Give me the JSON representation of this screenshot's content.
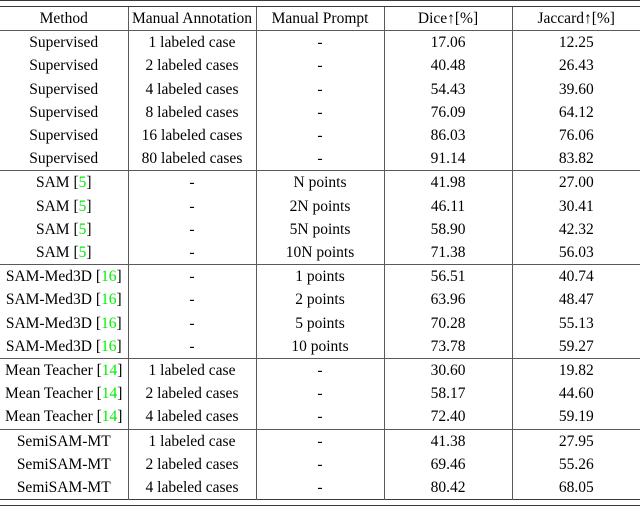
{
  "table": {
    "columns": [
      {
        "key": "method",
        "label": "Method"
      },
      {
        "key": "manual_annotation",
        "label": "Manual Annotation"
      },
      {
        "key": "manual_prompt",
        "label": "Manual Prompt"
      },
      {
        "key": "dice",
        "label": "Dice↑[%]"
      },
      {
        "key": "jaccard",
        "label": "Jaccard↑[%]"
      }
    ],
    "citation_color": "#00ee00",
    "groups": [
      {
        "name": "supervised",
        "rows": [
          {
            "method": "Supervised",
            "cite": "",
            "bold": false,
            "manual_annotation": "1 labeled case",
            "manual_prompt": "-",
            "dice": "17.06",
            "jaccard": "12.25"
          },
          {
            "method": "Supervised",
            "cite": "",
            "bold": false,
            "manual_annotation": "2 labeled cases",
            "manual_prompt": "-",
            "dice": "40.48",
            "jaccard": "26.43"
          },
          {
            "method": "Supervised",
            "cite": "",
            "bold": false,
            "manual_annotation": "4 labeled cases",
            "manual_prompt": "-",
            "dice": "54.43",
            "jaccard": "39.60"
          },
          {
            "method": "Supervised",
            "cite": "",
            "bold": false,
            "manual_annotation": "8 labeled cases",
            "manual_prompt": "-",
            "dice": "76.09",
            "jaccard": "64.12"
          },
          {
            "method": "Supervised",
            "cite": "",
            "bold": false,
            "manual_annotation": "16 labeled cases",
            "manual_prompt": "-",
            "dice": "86.03",
            "jaccard": "76.06"
          },
          {
            "method": "Supervised",
            "cite": "",
            "bold": false,
            "manual_annotation": "80 labeled cases",
            "manual_prompt": "-",
            "dice": "91.14",
            "jaccard": "83.82"
          }
        ]
      },
      {
        "name": "sam",
        "rows": [
          {
            "method": "SAM",
            "cite": "5",
            "bold": false,
            "manual_annotation": "-",
            "manual_prompt": "N points",
            "dice": "41.98",
            "jaccard": "27.00"
          },
          {
            "method": "SAM",
            "cite": "5",
            "bold": false,
            "manual_annotation": "-",
            "manual_prompt": "2N points",
            "dice": "46.11",
            "jaccard": "30.41"
          },
          {
            "method": "SAM",
            "cite": "5",
            "bold": false,
            "manual_annotation": "-",
            "manual_prompt": "5N points",
            "dice": "58.90",
            "jaccard": "42.32"
          },
          {
            "method": "SAM",
            "cite": "5",
            "bold": false,
            "manual_annotation": "-",
            "manual_prompt": "10N points",
            "dice": "71.38",
            "jaccard": "56.03"
          }
        ]
      },
      {
        "name": "sam-med3d",
        "rows": [
          {
            "method": "SAM-Med3D",
            "cite": "16",
            "bold": false,
            "manual_annotation": "-",
            "manual_prompt": "1 points",
            "dice": "56.51",
            "jaccard": "40.74"
          },
          {
            "method": "SAM-Med3D",
            "cite": "16",
            "bold": false,
            "manual_annotation": "-",
            "manual_prompt": "2 points",
            "dice": "63.96",
            "jaccard": "48.47"
          },
          {
            "method": "SAM-Med3D",
            "cite": "16",
            "bold": false,
            "manual_annotation": "-",
            "manual_prompt": "5 points",
            "dice": "70.28",
            "jaccard": "55.13"
          },
          {
            "method": "SAM-Med3D",
            "cite": "16",
            "bold": false,
            "manual_annotation": "-",
            "manual_prompt": "10 points",
            "dice": "73.78",
            "jaccard": "59.27"
          }
        ]
      },
      {
        "name": "mean-teacher",
        "rows": [
          {
            "method": "Mean Teacher",
            "cite": "14",
            "bold": false,
            "manual_annotation": "1 labeled case",
            "manual_prompt": "-",
            "dice": "30.60",
            "jaccard": "19.82"
          },
          {
            "method": "Mean Teacher",
            "cite": "14",
            "bold": false,
            "manual_annotation": "2 labeled cases",
            "manual_prompt": "-",
            "dice": "58.17",
            "jaccard": "44.60"
          },
          {
            "method": "Mean Teacher",
            "cite": "14",
            "bold": false,
            "manual_annotation": "4 labeled cases",
            "manual_prompt": "-",
            "dice": "72.40",
            "jaccard": "59.19"
          }
        ]
      },
      {
        "name": "semisam-mt",
        "rows": [
          {
            "method": "SemiSAM-MT",
            "cite": "",
            "bold": true,
            "manual_annotation": "1 labeled case",
            "manual_prompt": "-",
            "dice": "41.38",
            "jaccard": "27.95"
          },
          {
            "method": "SemiSAM-MT",
            "cite": "",
            "bold": true,
            "manual_annotation": "2 labeled cases",
            "manual_prompt": "-",
            "dice": "69.46",
            "jaccard": "55.26"
          },
          {
            "method": "SemiSAM-MT",
            "cite": "",
            "bold": true,
            "manual_annotation": "4 labeled cases",
            "manual_prompt": "-",
            "dice": "80.42",
            "jaccard": "68.05"
          }
        ]
      }
    ]
  }
}
